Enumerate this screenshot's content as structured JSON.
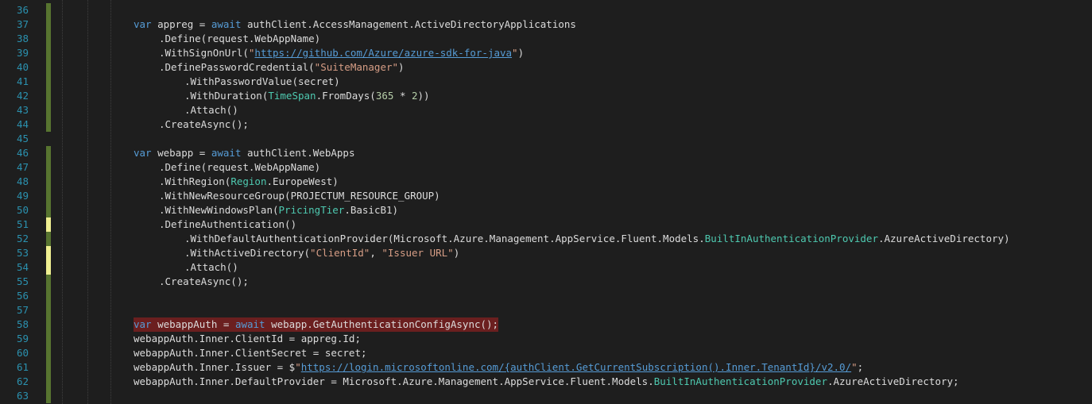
{
  "editor": {
    "lines": [
      {
        "num": "36",
        "marker": "saved",
        "indent": 0,
        "tokens": []
      },
      {
        "num": "37",
        "marker": "saved",
        "indent": 0,
        "tokens": [
          {
            "c": "kw",
            "t": "var"
          },
          {
            "c": "",
            "t": " appreg = "
          },
          {
            "c": "kw",
            "t": "await"
          },
          {
            "c": "",
            "t": " authClient.AccessManagement.ActiveDirectoryApplications"
          }
        ]
      },
      {
        "num": "38",
        "marker": "saved",
        "indent": 1,
        "tokens": [
          {
            "c": "",
            "t": ".Define(request.WebAppName)"
          }
        ]
      },
      {
        "num": "39",
        "marker": "saved",
        "indent": 1,
        "tokens": [
          {
            "c": "",
            "t": ".WithSignOnUrl("
          },
          {
            "c": "str",
            "t": "\""
          },
          {
            "c": "link",
            "t": "https://github.com/Azure/azure-sdk-for-java"
          },
          {
            "c": "str",
            "t": "\""
          },
          {
            "c": "",
            "t": ")"
          }
        ]
      },
      {
        "num": "40",
        "marker": "saved",
        "indent": 1,
        "tokens": [
          {
            "c": "",
            "t": ".DefinePasswordCredential("
          },
          {
            "c": "str",
            "t": "\"SuiteManager\""
          },
          {
            "c": "",
            "t": ")"
          }
        ]
      },
      {
        "num": "41",
        "marker": "saved",
        "indent": 2,
        "tokens": [
          {
            "c": "",
            "t": ".WithPasswordValue(secret)"
          }
        ]
      },
      {
        "num": "42",
        "marker": "saved",
        "indent": 2,
        "tokens": [
          {
            "c": "",
            "t": ".WithDuration("
          },
          {
            "c": "type",
            "t": "TimeSpan"
          },
          {
            "c": "",
            "t": ".FromDays("
          },
          {
            "c": "num",
            "t": "365"
          },
          {
            "c": "",
            "t": " * "
          },
          {
            "c": "num",
            "t": "2"
          },
          {
            "c": "",
            "t": "))"
          }
        ]
      },
      {
        "num": "43",
        "marker": "saved",
        "indent": 2,
        "tokens": [
          {
            "c": "",
            "t": ".Attach()"
          }
        ]
      },
      {
        "num": "44",
        "marker": "saved",
        "indent": 1,
        "tokens": [
          {
            "c": "",
            "t": ".CreateAsync();"
          }
        ]
      },
      {
        "num": "45",
        "marker": "none",
        "indent": 0,
        "tokens": []
      },
      {
        "num": "46",
        "marker": "saved",
        "indent": 0,
        "tokens": [
          {
            "c": "kw",
            "t": "var"
          },
          {
            "c": "",
            "t": " webapp = "
          },
          {
            "c": "kw",
            "t": "await"
          },
          {
            "c": "",
            "t": " authClient.WebApps"
          }
        ]
      },
      {
        "num": "47",
        "marker": "saved",
        "indent": 1,
        "tokens": [
          {
            "c": "",
            "t": ".Define(request.WebAppName)"
          }
        ]
      },
      {
        "num": "48",
        "marker": "saved",
        "indent": 1,
        "tokens": [
          {
            "c": "",
            "t": ".WithRegion("
          },
          {
            "c": "type",
            "t": "Region"
          },
          {
            "c": "",
            "t": ".EuropeWest)"
          }
        ]
      },
      {
        "num": "49",
        "marker": "saved",
        "indent": 1,
        "tokens": [
          {
            "c": "",
            "t": ".WithNewResourceGroup(PROJECTUM_RESOURCE_GROUP)"
          }
        ]
      },
      {
        "num": "50",
        "marker": "saved",
        "indent": 1,
        "tokens": [
          {
            "c": "",
            "t": ".WithNewWindowsPlan("
          },
          {
            "c": "type",
            "t": "PricingTier"
          },
          {
            "c": "",
            "t": ".BasicB1)"
          }
        ]
      },
      {
        "num": "51",
        "marker": "unsaved",
        "indent": 1,
        "tokens": [
          {
            "c": "",
            "t": ".DefineAuthentication()"
          }
        ]
      },
      {
        "num": "52",
        "marker": "saved",
        "indent": 2,
        "tokens": [
          {
            "c": "",
            "t": ".WithDefaultAuthenticationProvider(Microsoft.Azure.Management.AppService.Fluent.Models."
          },
          {
            "c": "type",
            "t": "BuiltInAuthenticationProvider"
          },
          {
            "c": "",
            "t": ".AzureActiveDirectory)"
          }
        ]
      },
      {
        "num": "53",
        "marker": "unsaved",
        "indent": 2,
        "tokens": [
          {
            "c": "",
            "t": ".WithActiveDirectory("
          },
          {
            "c": "str",
            "t": "\"ClientId\""
          },
          {
            "c": "",
            "t": ", "
          },
          {
            "c": "str",
            "t": "\"Issuer URL\""
          },
          {
            "c": "",
            "t": ")"
          }
        ]
      },
      {
        "num": "54",
        "marker": "unsaved",
        "indent": 2,
        "tokens": [
          {
            "c": "",
            "t": ".Attach()"
          }
        ]
      },
      {
        "num": "55",
        "marker": "saved",
        "indent": 1,
        "tokens": [
          {
            "c": "",
            "t": ".CreateAsync();"
          }
        ]
      },
      {
        "num": "56",
        "marker": "saved",
        "indent": 0,
        "tokens": []
      },
      {
        "num": "57",
        "marker": "saved",
        "indent": 0,
        "tokens": []
      },
      {
        "num": "58",
        "marker": "saved",
        "indent": 0,
        "error": true,
        "tokens": [
          {
            "c": "kw",
            "t": "var"
          },
          {
            "c": "",
            "t": " webappAuth = "
          },
          {
            "c": "kw",
            "t": "await"
          },
          {
            "c": "",
            "t": " webapp.GetAuthenticationConfigAsync();"
          }
        ]
      },
      {
        "num": "59",
        "marker": "saved",
        "indent": 0,
        "tokens": [
          {
            "c": "",
            "t": "webappAuth.Inner.ClientId = appreg.Id;"
          }
        ]
      },
      {
        "num": "60",
        "marker": "saved",
        "indent": 0,
        "tokens": [
          {
            "c": "",
            "t": "webappAuth.Inner.ClientSecret = secret;"
          }
        ]
      },
      {
        "num": "61",
        "marker": "saved",
        "indent": 0,
        "tokens": [
          {
            "c": "",
            "t": "webappAuth.Inner.Issuer = $"
          },
          {
            "c": "str",
            "t": "\""
          },
          {
            "c": "link",
            "t": "https://login.microsoftonline.com/{authClient.GetCurrentSubscription().Inner.TenantId}/v2.0/"
          },
          {
            "c": "str",
            "t": "\""
          },
          {
            "c": "",
            "t": ";"
          }
        ]
      },
      {
        "num": "62",
        "marker": "saved",
        "indent": 0,
        "tokens": [
          {
            "c": "",
            "t": "webappAuth.Inner.DefaultProvider = Microsoft.Azure.Management.AppService.Fluent.Models."
          },
          {
            "c": "type",
            "t": "BuiltInAuthenticationProvider"
          },
          {
            "c": "",
            "t": ".AzureActiveDirectory;"
          }
        ]
      },
      {
        "num": "63",
        "marker": "saved",
        "indent": 0,
        "tokens": []
      }
    ]
  },
  "colors": {
    "background": "#1e1e1e",
    "line_number": "#2b91af",
    "keyword": "#569cd6",
    "type": "#4ec9b0",
    "string": "#d69d85",
    "number": "#b5cea8",
    "error_highlight": "#6b1f1f",
    "change_saved": "#577430",
    "change_unsaved": "#efef91"
  }
}
